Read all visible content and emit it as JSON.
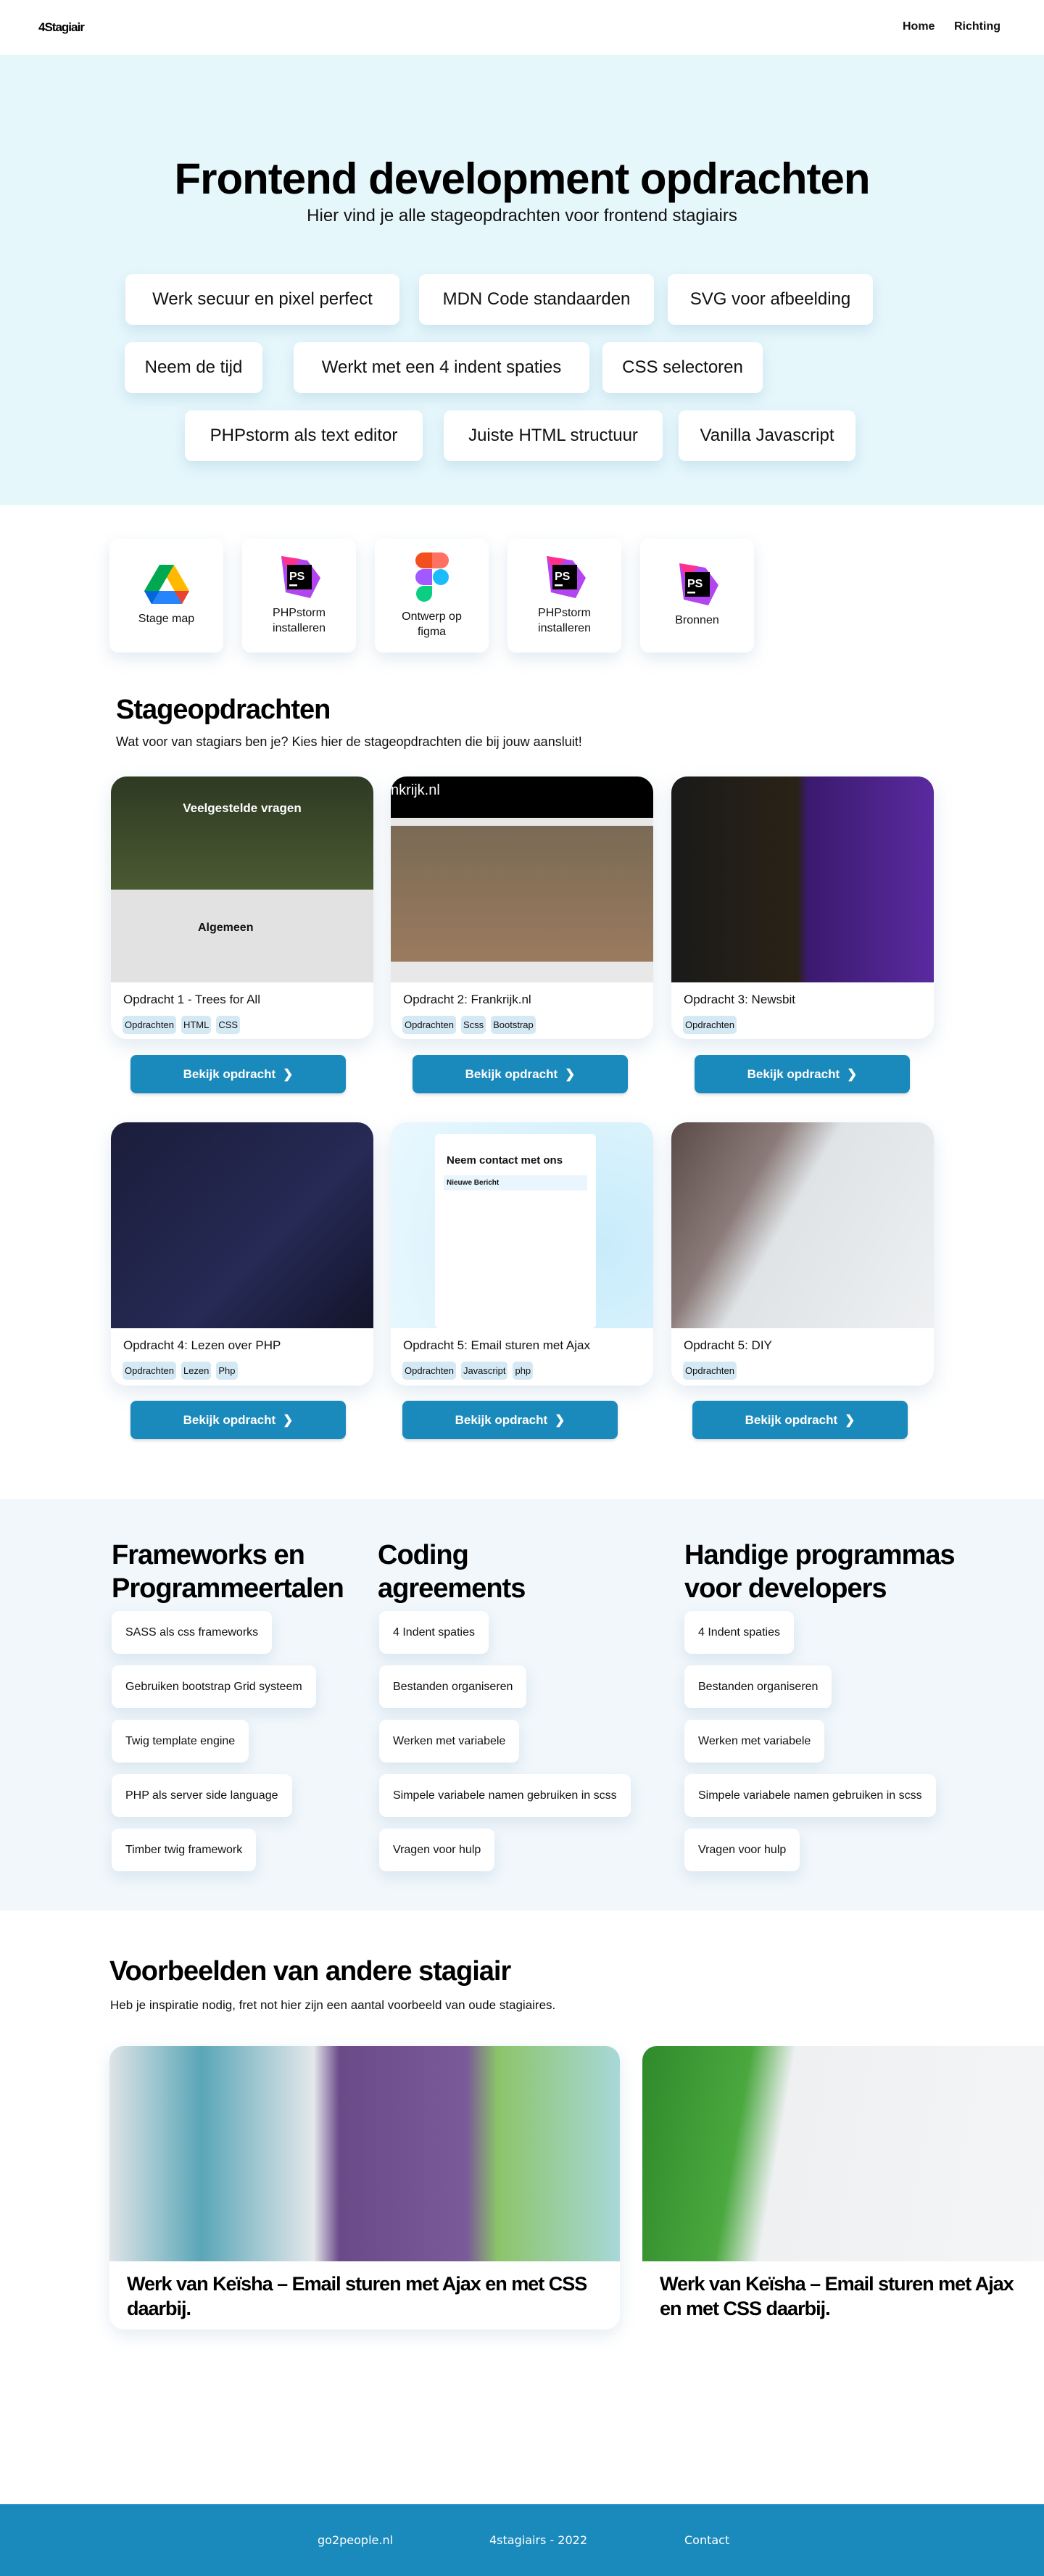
{
  "nav": {
    "logo": "4Stagiair",
    "links": [
      "Home",
      "Richting"
    ]
  },
  "hero": {
    "title": "Frontend development opdrachten",
    "subtitle": "Hier vind je alle stageopdrachten voor frontend stagiairs",
    "chips": [
      "Werk secuur en pixel perfect",
      "MDN Code standaarden",
      "SVG voor afbeelding",
      "Neem de tijd",
      "Werkt met een 4 indent spaties",
      "CSS selectoren",
      "PHPstorm als text editor",
      "Juiste HTML structuur",
      "Vanilla Javascript"
    ]
  },
  "quick_links": [
    {
      "label": "Stage map",
      "icon": "google-drive-icon"
    },
    {
      "label": "PHPstorm installeren",
      "icon": "phpstorm-icon"
    },
    {
      "label": "Ontwerp op figma",
      "icon": "figma-icon"
    },
    {
      "label": "PHPstorm installeren",
      "icon": "phpstorm-icon"
    },
    {
      "label": "Bronnen",
      "icon": "phpstorm-icon"
    }
  ],
  "assignments": {
    "title": "Stageopdrachten",
    "subtitle": "Wat voor van stagiars ben je? Kies hier de stageopdrachten die bij jouw aansluit!",
    "button_label": "Bekijk opdracht",
    "cards": [
      {
        "title": "Opdracht 1  - Trees for All",
        "tags": [
          "Opdrachten",
          "HTML",
          "CSS"
        ],
        "image_caption": "Veelgestelde vragen",
        "image_sub": "Algemeen"
      },
      {
        "title": "Opdracht 2: Frankrijk.nl",
        "tags": [
          "Opdrachten",
          "Scss",
          "Bootstrap"
        ],
        "image_caption": "nkrijk.nl"
      },
      {
        "title": "Opdracht 3: Newsbit",
        "tags": [
          "Opdrachten"
        ]
      },
      {
        "title": "Opdracht 4: Lezen over PHP",
        "tags": [
          "Opdrachten",
          "Lezen",
          "Php"
        ]
      },
      {
        "title": "Opdracht 5: Email sturen met Ajax",
        "tags": [
          "Opdrachten",
          "Javascript",
          "php"
        ],
        "image_caption": "Neem contact met ons",
        "image_sub": "Nieuwe Bericht"
      },
      {
        "title": "Opdracht 5: DIY",
        "tags": [
          "Opdrachten"
        ]
      }
    ]
  },
  "columns": [
    {
      "title": "Frameworks en Programmeertalen",
      "items": [
        "SASS als css frameworks",
        "Gebruiken bootstrap Grid systeem",
        "Twig template engine",
        "PHP als server side language",
        "Timber twig framework"
      ]
    },
    {
      "title": "Coding agreements",
      "items": [
        "4 Indent spaties",
        "Bestanden organiseren",
        "Werken met variabele",
        "Simpele variabele namen gebruiken in scss",
        "Vragen voor hulp"
      ]
    },
    {
      "title": "Handige programmas voor developers",
      "items": [
        "4 Indent spaties",
        "Bestanden organiseren",
        "Werken met variabele",
        "Simpele variabele namen gebruiken in scss",
        "Vragen voor hulp"
      ]
    }
  ],
  "examples": {
    "title": "Voorbeelden van andere stagiair",
    "subtitle": "Heb je inspiratie  nodig, fret not  hier zijn een aantal voorbeeld van oude stagiaires.",
    "cards": [
      {
        "title": "Werk van Keïsha – Email sturen met Ajax en met CSS daarbij."
      },
      {
        "title": "Werk van Keïsha – Email sturen met Ajax en met CSS daarbij."
      }
    ]
  },
  "footer": {
    "links": [
      "go2people.nl",
      "4stagiairs - 2022",
      "Contact"
    ]
  },
  "colors": {
    "accent": "#1a8abd",
    "hero_bg": "#e6f7fc",
    "tag_bg": "#d4e9f4"
  }
}
